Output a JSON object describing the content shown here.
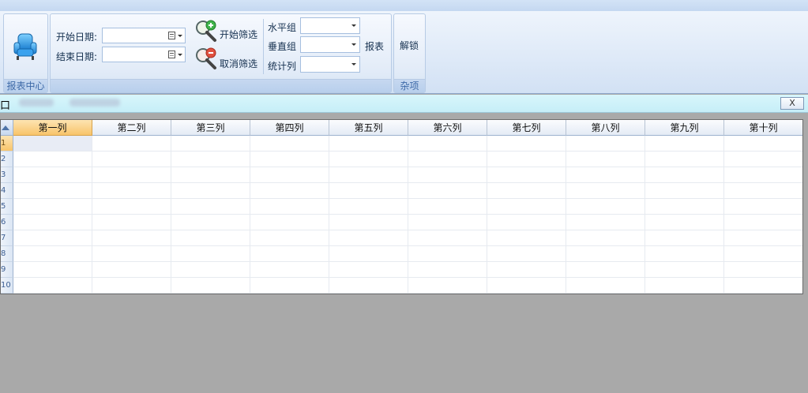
{
  "ribbon": {
    "groups": {
      "report_center": {
        "label": "报表中心"
      },
      "misc": {
        "label": "杂项"
      }
    },
    "start_date_label": "开始日期:",
    "end_date_label": "结束日期:",
    "start_date_value": "",
    "end_date_value": "",
    "start_filter_label": "开始筛选",
    "cancel_filter_label": "取消筛选",
    "horizontal_group_label": "水平组",
    "vertical_group_label": "垂直组",
    "stat_column_label": "统计列",
    "horizontal_group_value": "",
    "vertical_group_value": "",
    "stat_column_value": "",
    "report_label": "报表",
    "unlock_label": "解锁"
  },
  "tabbar": {
    "prefix": "口",
    "close_symbol": "X"
  },
  "grid": {
    "columns": [
      "第一列",
      "第二列",
      "第三列",
      "第四列",
      "第五列",
      "第六列",
      "第七列",
      "第八列",
      "第九列",
      "第十列"
    ],
    "row_numbers": [
      "1",
      "2",
      "3",
      "4",
      "5",
      "6",
      "7",
      "8",
      "9",
      "10"
    ],
    "selected_column": "第一列",
    "selected_row": "1"
  },
  "colors": {
    "accent": "#f8c46a",
    "ribbon_label": "#3e6aa8",
    "workspace": "#a9a9a9"
  }
}
